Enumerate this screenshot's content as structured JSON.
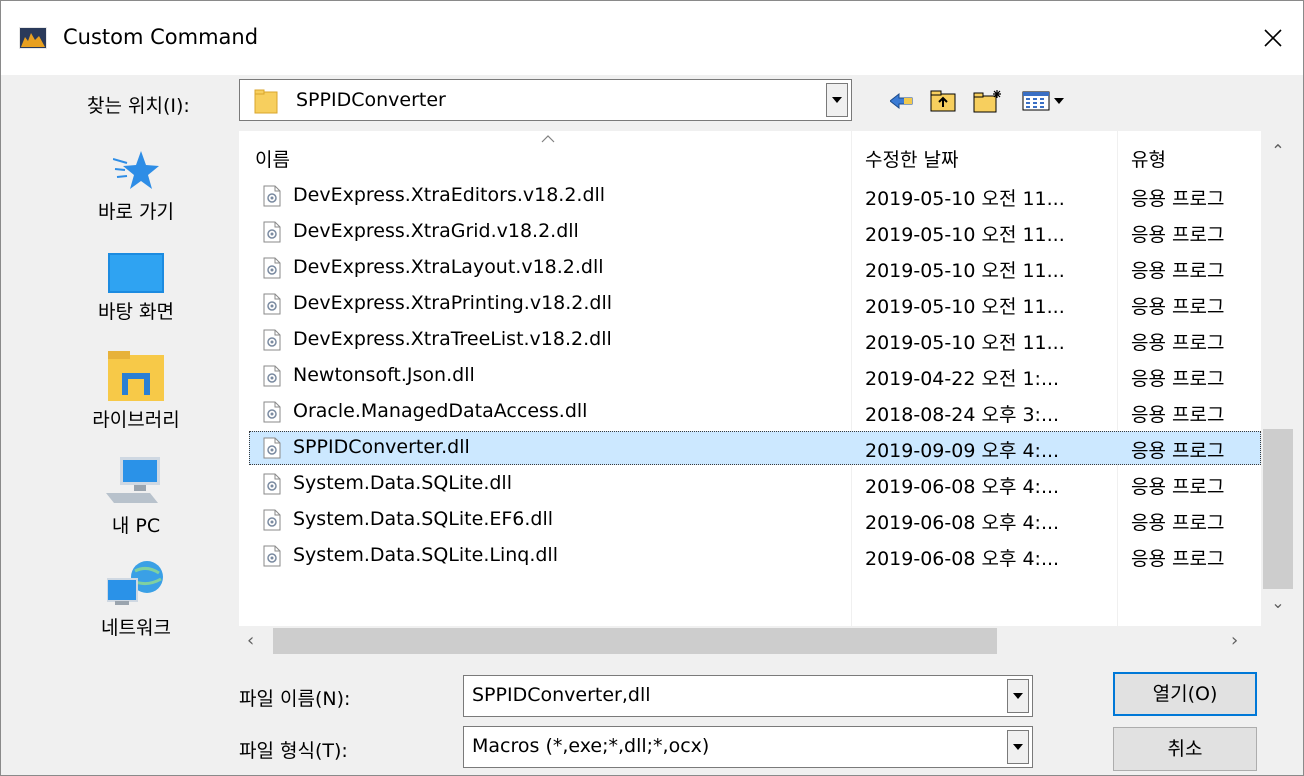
{
  "window": {
    "title": "Custom Command"
  },
  "lookin": {
    "label": "찾는 위치(I):",
    "value": "SPPIDConverter"
  },
  "places": [
    {
      "label": "바로 가기",
      "icon": "quick-access-star-icon"
    },
    {
      "label": "바탕 화면",
      "icon": "desktop-icon"
    },
    {
      "label": "라이브러리",
      "icon": "libraries-icon"
    },
    {
      "label": "내 PC",
      "icon": "this-pc-icon"
    },
    {
      "label": "네트워크",
      "icon": "network-icon"
    }
  ],
  "list": {
    "columns": {
      "name": "이름",
      "date": "수정한 날짜",
      "type": "유형"
    },
    "rows": [
      {
        "name": "DevExpress.XtraEditors.v18.2.dll",
        "date": "2019-05-10 오전 11...",
        "type": "응용 프로그"
      },
      {
        "name": "DevExpress.XtraGrid.v18.2.dll",
        "date": "2019-05-10 오전 11...",
        "type": "응용 프로그"
      },
      {
        "name": "DevExpress.XtraLayout.v18.2.dll",
        "date": "2019-05-10 오전 11...",
        "type": "응용 프로그"
      },
      {
        "name": "DevExpress.XtraPrinting.v18.2.dll",
        "date": "2019-05-10 오전 11...",
        "type": "응용 프로그"
      },
      {
        "name": "DevExpress.XtraTreeList.v18.2.dll",
        "date": "2019-05-10 오전 11...",
        "type": "응용 프로그"
      },
      {
        "name": "Newtonsoft.Json.dll",
        "date": "2019-04-22 오전 1:...",
        "type": "응용 프로그"
      },
      {
        "name": "Oracle.ManagedDataAccess.dll",
        "date": "2018-08-24 오후 3:...",
        "type": "응용 프로그"
      },
      {
        "name": "SPPIDConverter.dll",
        "date": "2019-09-09 오후 4:...",
        "type": "응용 프로그",
        "selected": true
      },
      {
        "name": "System.Data.SQLite.dll",
        "date": "2019-06-08 오후 4:...",
        "type": "응용 프로그"
      },
      {
        "name": "System.Data.SQLite.EF6.dll",
        "date": "2019-06-08 오후 4:...",
        "type": "응용 프로그"
      },
      {
        "name": "System.Data.SQLite.Linq.dll",
        "date": "2019-06-08 오후 4:...",
        "type": "응용 프로그"
      }
    ]
  },
  "filename": {
    "label": "파일 이름(N):",
    "value": "SPPIDConverter,dll"
  },
  "filetype": {
    "label": "파일 형식(T):",
    "value": "Macros (*,exe;*,dll;*,ocx)"
  },
  "buttons": {
    "open": "열기(O)",
    "cancel": "취소"
  },
  "colors": {
    "selection": "#cce8ff",
    "accent": "#0078d7"
  }
}
